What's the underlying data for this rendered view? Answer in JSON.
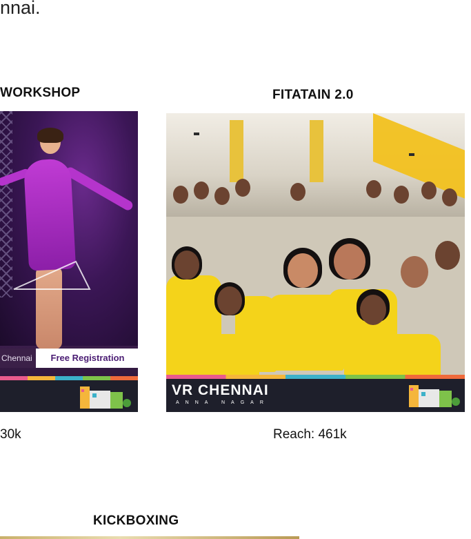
{
  "intro_text": "nnai.",
  "cards": [
    {
      "title": "WORKSHOP",
      "reach": "30k",
      "poster": {
        "brand_left": "Chennai",
        "registration_label": "Free Registration"
      }
    },
    {
      "title": "FITATAIN 2.0",
      "reach": "Reach: 461k",
      "poster": {
        "brand": "VR CHENNAI",
        "brand_sub": "ANNA NAGAR"
      }
    },
    {
      "title": "KICKBOXING"
    }
  ],
  "colors": {
    "yellow_shirt": "#f4d31a",
    "purple_dress": "#c03bd4",
    "footer_dark": "#1e1f2b"
  }
}
